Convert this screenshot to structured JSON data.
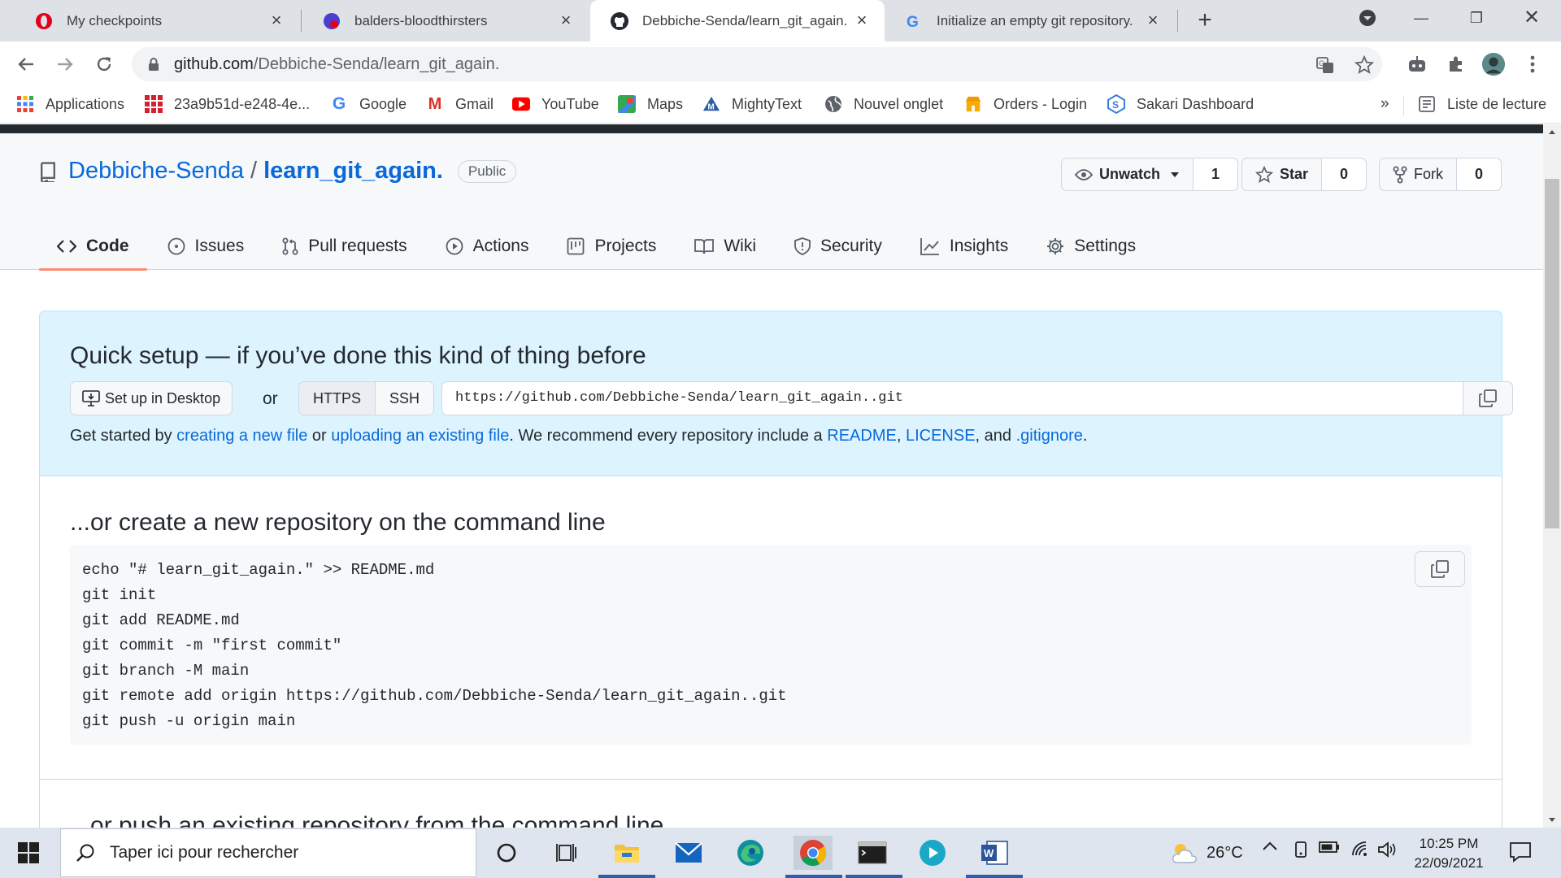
{
  "browser": {
    "tabs": [
      {
        "title": "My checkpoints",
        "active": false
      },
      {
        "title": "balders-bloodthirsters",
        "active": false
      },
      {
        "title": "Debbiche-Senda/learn_git_again.",
        "active": true
      },
      {
        "title": "Initialize an empty git repository.",
        "active": false
      }
    ],
    "url_host": "github.com",
    "url_path": "/Debbiche-Senda/learn_git_again."
  },
  "bookmarks": {
    "items": [
      {
        "label": "Applications"
      },
      {
        "label": "23a9b51d-e248-4e..."
      },
      {
        "label": "Google"
      },
      {
        "label": "Gmail"
      },
      {
        "label": "YouTube"
      },
      {
        "label": "Maps"
      },
      {
        "label": "MightyText"
      },
      {
        "label": "Nouvel onglet"
      },
      {
        "label": "Orders - Login"
      },
      {
        "label": "Sakari Dashboard"
      }
    ],
    "overflow": "»",
    "reading_list": "Liste de lecture"
  },
  "repo": {
    "owner": "Debbiche-Senda",
    "separator": "/",
    "name": "learn_git_again.",
    "visibility": "Public",
    "watch_label": "Unwatch",
    "watch_count": "1",
    "star_label": "Star",
    "star_count": "0",
    "fork_label": "Fork",
    "fork_count": "0"
  },
  "nav": {
    "code": "Code",
    "issues": "Issues",
    "pulls": "Pull requests",
    "actions": "Actions",
    "projects": "Projects",
    "wiki": "Wiki",
    "security": "Security",
    "insights": "Insights",
    "settings": "Settings"
  },
  "quick_setup": {
    "heading": "Quick setup — if you’ve done this kind of thing before",
    "desktop_button": "Set up in Desktop",
    "or": "or",
    "https": "HTTPS",
    "ssh": "SSH",
    "clone_url": "https://github.com/Debbiche-Senda/learn_git_again..git",
    "help_prefix": "Get started by ",
    "help_link1": "creating a new file",
    "help_mid1": " or ",
    "help_link2": "uploading an existing file",
    "help_mid2": ". We recommend every repository include a ",
    "help_link3": "README",
    "help_sep1": ", ",
    "help_link4": "LICENSE",
    "help_sep2": ", and ",
    "help_link5": ".gitignore",
    "help_end": "."
  },
  "new_repo": {
    "heading": "...or create a new repository on the command line",
    "code": "echo \"# learn_git_again.\" >> README.md\ngit init\ngit add README.md\ngit commit -m \"first commit\"\ngit branch -M main\ngit remote add origin https://github.com/Debbiche-Senda/learn_git_again..git\ngit push -u origin main"
  },
  "push_existing": {
    "heading": "...or push an existing repository from the command line"
  },
  "taskbar": {
    "search_placeholder": "Taper ici pour rechercher",
    "temperature": "26°C",
    "time": "10:25 PM",
    "date": "22/09/2021"
  },
  "colors": {
    "link": "#0969da",
    "tab_underline": "#fd8c73",
    "quick_bg": "#ddf4ff"
  }
}
